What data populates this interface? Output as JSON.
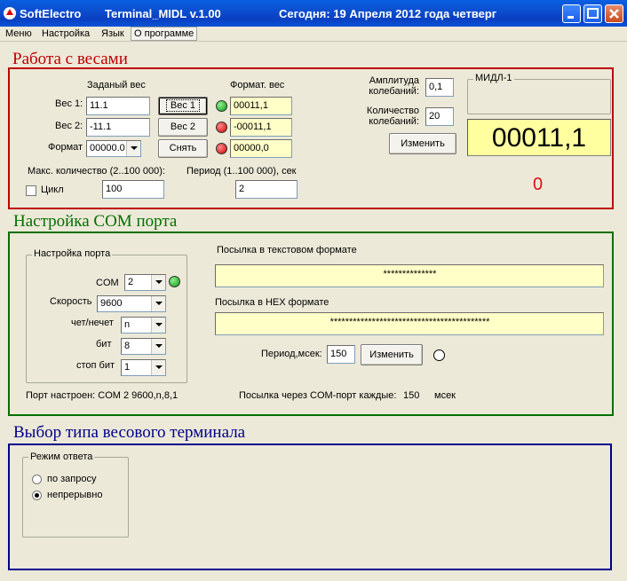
{
  "titlebar": {
    "app": "SoftElectro",
    "window": "Terminal_MIDL v.1.00",
    "today": "Сегодня: 19  Апреля  2012 года  четверг"
  },
  "menu": [
    "Меню",
    "Настройка",
    "Язык",
    "О программе"
  ],
  "weights": {
    "section_title": "Работа с весами",
    "set_weight_header": "Заданый вес",
    "format_header": "Формат. вес",
    "weight1_label": "Вес 1:",
    "weight1_value": "11.1",
    "weight2_label": "Вес 2:",
    "weight2_value": "-11.1",
    "format_label": "Формат",
    "format_value": "00000.0",
    "btn_weight1": "Вес 1",
    "btn_weight2": "Вес 2",
    "btn_remove": "Снять",
    "fmt1": "00011,1",
    "fmt2": "-00011,1",
    "fmt3": "00000,0",
    "max_count_label": "Макс. количество (2..100 000):",
    "max_count_value": "100",
    "cycle_label": "Цикл",
    "period_label": "Период (1..100 000), сек",
    "period_value": "2",
    "amplitude_label_1": "Амплитуда",
    "amplitude_label_2": "колебаний:",
    "amplitude_value": "0,1",
    "osc_count_label_1": "Количество",
    "osc_count_label_2": "колебаний:",
    "osc_count_value": "20",
    "change_btn": "Изменить",
    "midl_title": "МИДЛ-1",
    "display_value": "00011,1",
    "counter": "0"
  },
  "com": {
    "section_title": "Настройка COM порта",
    "group_title": "Настройка порта",
    "com_label": "COM",
    "com_value": "2",
    "speed_label": "Скорость",
    "speed_value": "9600",
    "parity_label": "чет/нечет",
    "parity_value": "n",
    "bits_label": "бит",
    "bits_value": "8",
    "stop_label": "стоп бит",
    "stop_value": "1",
    "port_status": "Порт настроен: COM 2   9600,n,8,1",
    "text_send_label": "Посылка в текстовом формате",
    "text_send_value": "**************",
    "hex_send_label": "Посылка в HEX формате",
    "hex_send_value": "******************************************",
    "period_label": "Период,мсек:",
    "period_value": "150",
    "change_btn": "Изменить",
    "every_label": "Посылка через COM-порт каждые:",
    "every_value": "150",
    "every_unit": "мсек"
  },
  "terminal": {
    "section_title": "Выбор типа весового терминала",
    "group_title": "Режим ответа",
    "option_request": "по запросу",
    "option_continuous": "непрерывно"
  },
  "colors": {
    "weights_border": "#c00000",
    "com_border": "#007000",
    "terminal_border": "#00008b"
  }
}
